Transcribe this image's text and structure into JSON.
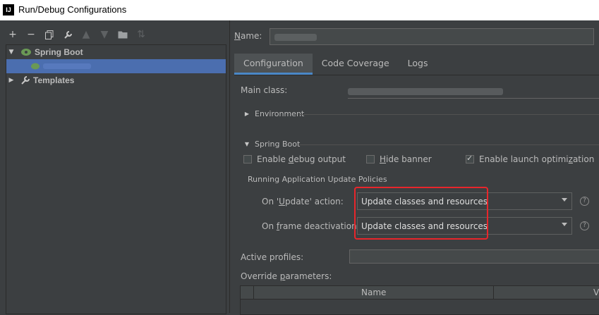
{
  "window": {
    "title": "Run/Debug Configurations",
    "app_icon": "IJ"
  },
  "toolbar": {
    "items": [
      "add-icon",
      "remove-icon",
      "copy-icon",
      "wrench-icon",
      "move-up-icon",
      "move-down-icon",
      "new-folder-icon",
      "sort-icon"
    ]
  },
  "tree": {
    "spring_boot": "Spring Boot",
    "templates": "Templates"
  },
  "name_field": {
    "label": "Name:"
  },
  "tabs": [
    "Configuration",
    "Code Coverage",
    "Logs"
  ],
  "config": {
    "main_class_label": "Main class:",
    "environment": "Environment",
    "spring_boot_section": "Spring Boot",
    "enable_debug_output": "Enable debug output",
    "hide_banner": "Hide banner",
    "enable_launch_optimization": "Enable launch optimization",
    "enable_debug_checked": false,
    "hide_banner_checked": false,
    "launch_opt_checked": true,
    "update_policies": "Running Application Update Policies",
    "on_update_label": "On 'Update' action:",
    "on_update_value": "Update classes and resources",
    "on_frame_label": "On frame deactivation:",
    "on_frame_value": "Update classes and resources",
    "active_profiles": "Active profiles:",
    "override_parameters": "Override parameters:",
    "table_col_name": "Name",
    "table_col_value": "Va"
  },
  "colors": {
    "selection": "#4b6eaf",
    "tab_underline": "#4a88c7",
    "highlight_box": "#e8262b"
  }
}
